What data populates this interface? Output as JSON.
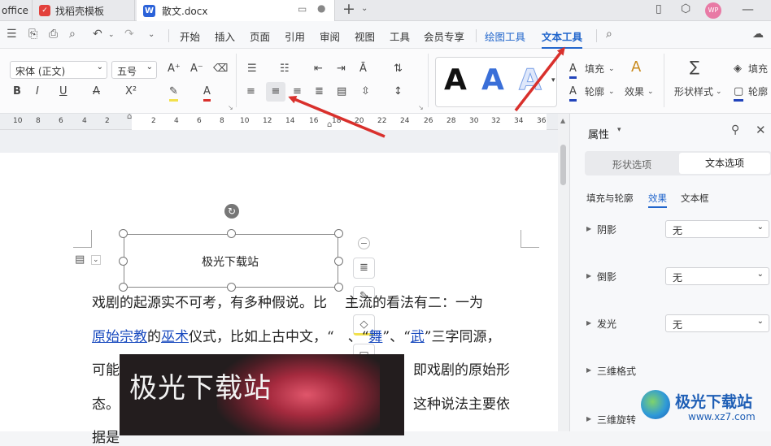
{
  "tabs": [
    {
      "label": "office"
    },
    {
      "label": "找稻壳模板"
    },
    {
      "label": "散文.docx"
    }
  ],
  "menu": {
    "items": [
      "开始",
      "插入",
      "页面",
      "引用",
      "审阅",
      "视图",
      "工具",
      "会员专享"
    ],
    "drawing_tools": "绘图工具",
    "text_tools": "文本工具"
  },
  "ribbon": {
    "font_name": "宋体 (正文)",
    "font_size": "五号",
    "fill_label": "填充",
    "outline_label": "轮廓",
    "effect_label": "效果",
    "shape_style_label": "形状样式",
    "fill_label_2": "填充",
    "outline_label_2": "轮廓",
    "style_letter": "A"
  },
  "ruler": [
    "10",
    "8",
    "6",
    "4",
    "2",
    "2",
    "4",
    "6",
    "8",
    "10",
    "12",
    "14",
    "16",
    "18",
    "20",
    "22",
    "24",
    "26",
    "28",
    "30",
    "32",
    "34",
    "36"
  ],
  "document": {
    "textbox_text": "极光下载站",
    "image_text": "极光下载站",
    "line1_a": "戏剧的起源实不可考，有多种假说。比",
    "line1_b": "主流的看法有二：一为",
    "line2_link1": "原始宗教",
    "line2_t1": "的",
    "line2_link2": "巫术",
    "line2_t2": "仪式，比如上古中文，“",
    "line2_t3": "、“",
    "line2_link3": "舞",
    "line2_t4": "”、“",
    "line2_link4": "武",
    "line2_t5": "”三字同源，",
    "line3_a": "可能",
    "line3_b": "即戏剧的原始形",
    "line4_a": "态。",
    "line4_b": "这种说法主要依",
    "line5_a": "据是"
  },
  "panel": {
    "title": "属性",
    "tab_shape": "形状选项",
    "tab_text": "文本选项",
    "subtabs": [
      "填充与轮廓",
      "效果",
      "文本框"
    ],
    "rows": [
      {
        "label": "阴影",
        "value": "无"
      },
      {
        "label": "倒影",
        "value": "无"
      },
      {
        "label": "发光",
        "value": "无"
      },
      {
        "label": "三维格式",
        "value": ""
      },
      {
        "label": "三维旋转",
        "value": ""
      }
    ]
  },
  "watermark": {
    "text": "极光下载站",
    "url": "www.xz7.com"
  },
  "avatar_initials": "WP",
  "colors": {
    "accent": "#2266cc",
    "arrow": "#d9302c",
    "dark_image": "#231d1e"
  }
}
